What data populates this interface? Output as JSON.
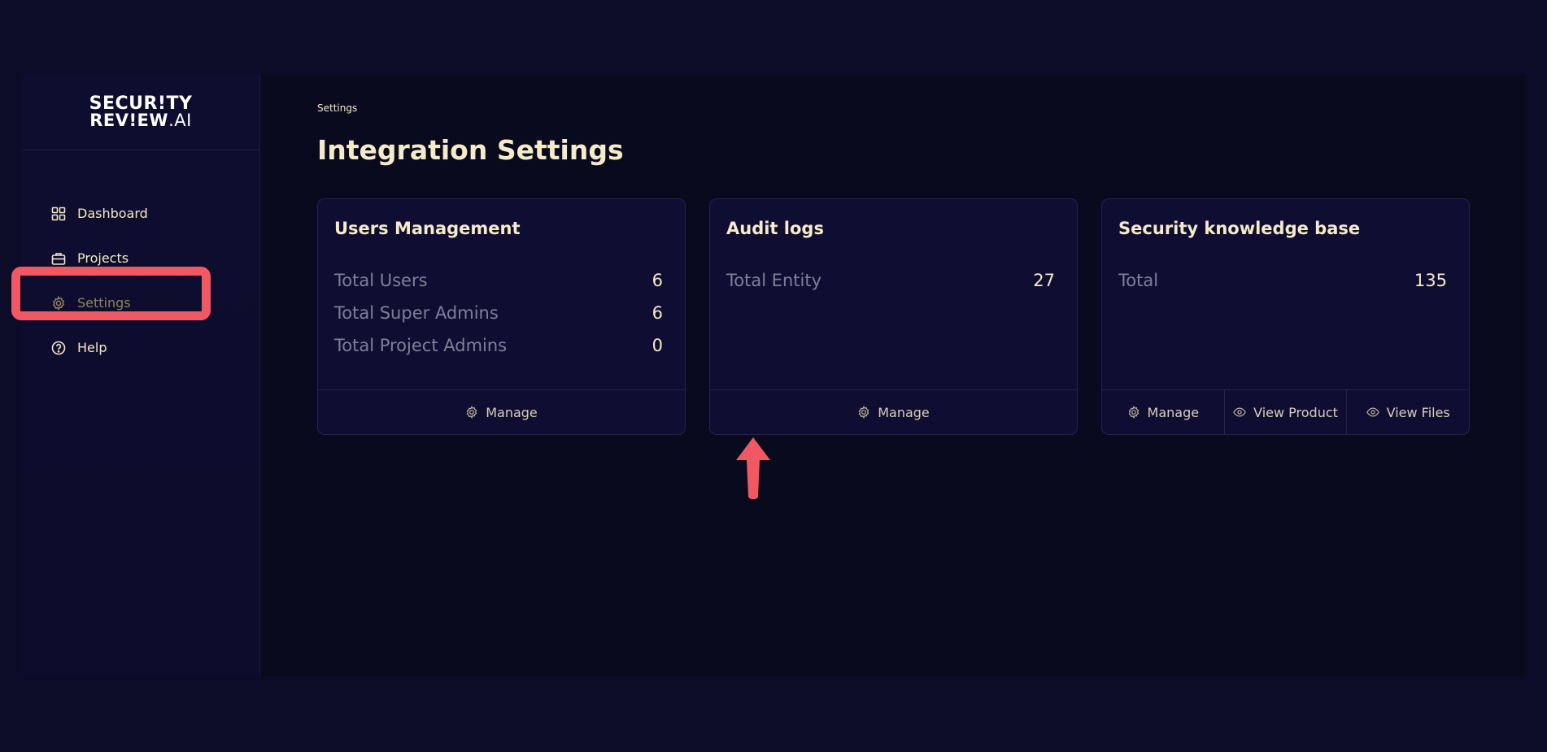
{
  "logo": {
    "line1": "SECUR!TY",
    "line2_main": "REV!EW",
    "line2_suffix": ".AI"
  },
  "sidebar": {
    "items": [
      {
        "label": "Dashboard",
        "icon": "grid-icon"
      },
      {
        "label": "Projects",
        "icon": "briefcase-icon"
      },
      {
        "label": "Settings",
        "icon": "gear-icon",
        "active": true
      },
      {
        "label": "Help",
        "icon": "help-circle-icon"
      }
    ]
  },
  "breadcrumb": "Settings",
  "page_title": "Integration Settings",
  "cards": [
    {
      "title": "Users Management",
      "stats": [
        {
          "label": "Total Users",
          "value": "6"
        },
        {
          "label": "Total Super Admins",
          "value": "6"
        },
        {
          "label": "Total Project Admins",
          "value": "0"
        }
      ],
      "actions": [
        {
          "label": "Manage",
          "icon": "gear-icon"
        }
      ]
    },
    {
      "title": "Audit logs",
      "stats": [
        {
          "label": "Total Entity",
          "value": "27"
        }
      ],
      "actions": [
        {
          "label": "Manage",
          "icon": "gear-icon"
        }
      ]
    },
    {
      "title": "Security knowledge base",
      "stats": [
        {
          "label": "Total",
          "value": "135"
        }
      ],
      "actions": [
        {
          "label": "Manage",
          "icon": "gear-icon"
        },
        {
          "label": "View Product",
          "icon": "eye-icon"
        },
        {
          "label": "View Files",
          "icon": "eye-icon"
        }
      ]
    }
  ],
  "colors": {
    "highlight": "#f25864",
    "accent_text": "#f3e9c6",
    "background": "#0c0b28"
  }
}
